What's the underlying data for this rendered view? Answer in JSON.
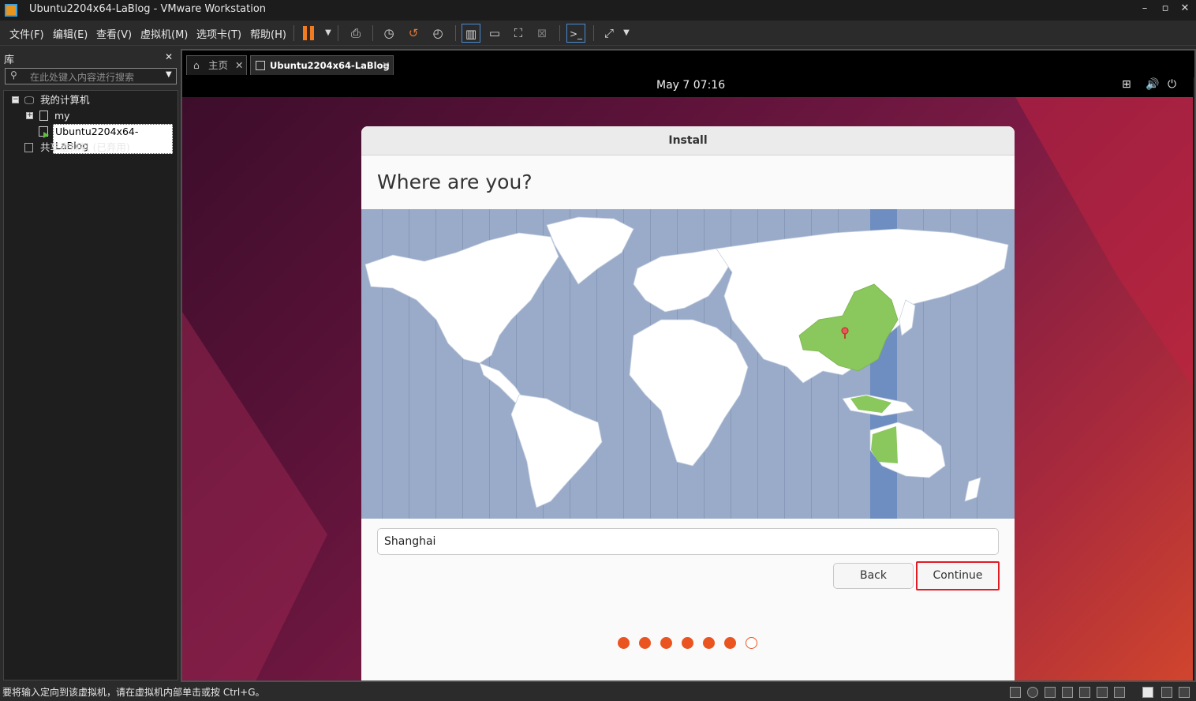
{
  "window": {
    "title": "Ubuntu2204x64-LaBlog - VMware Workstation",
    "controls": [
      "–",
      "▫",
      "✕"
    ]
  },
  "menu": [
    "文件(F)",
    "编辑(E)",
    "查看(V)",
    "虚拟机(M)",
    "选项卡(T)",
    "帮助(H)"
  ],
  "library": {
    "title": "库",
    "close": "✕",
    "search_placeholder": "在此处键入内容进行搜索",
    "tree": {
      "root": "我的计算机",
      "child_folder": "my",
      "vm": "Ubuntu2204x64-LaBlog",
      "shared": "共享虚拟机 (已弃用)"
    }
  },
  "tabs": [
    {
      "label": "主页",
      "close": "✕"
    },
    {
      "label": "Ubuntu2204x64-LaBlog",
      "close": "✕"
    }
  ],
  "guest": {
    "clock": "May 7  07:16",
    "installer": {
      "header": "Install",
      "heading": "Where are you?",
      "location_value": "Shanghai",
      "back_label": "Back",
      "continue_label": "Continue",
      "progress": {
        "completed_steps": 6,
        "total_steps": 7
      }
    }
  },
  "statusbar": {
    "message": "要将输入定向到该虚拟机，请在虚拟机内部单击或按 Ctrl+G。"
  },
  "colors": {
    "ubuntu_orange": "#e95420",
    "highlight_red": "#e01b24",
    "map_ocean": "#99abc9",
    "selected_zone": "#6e8dc1",
    "selected_country": "#8ac75d"
  }
}
